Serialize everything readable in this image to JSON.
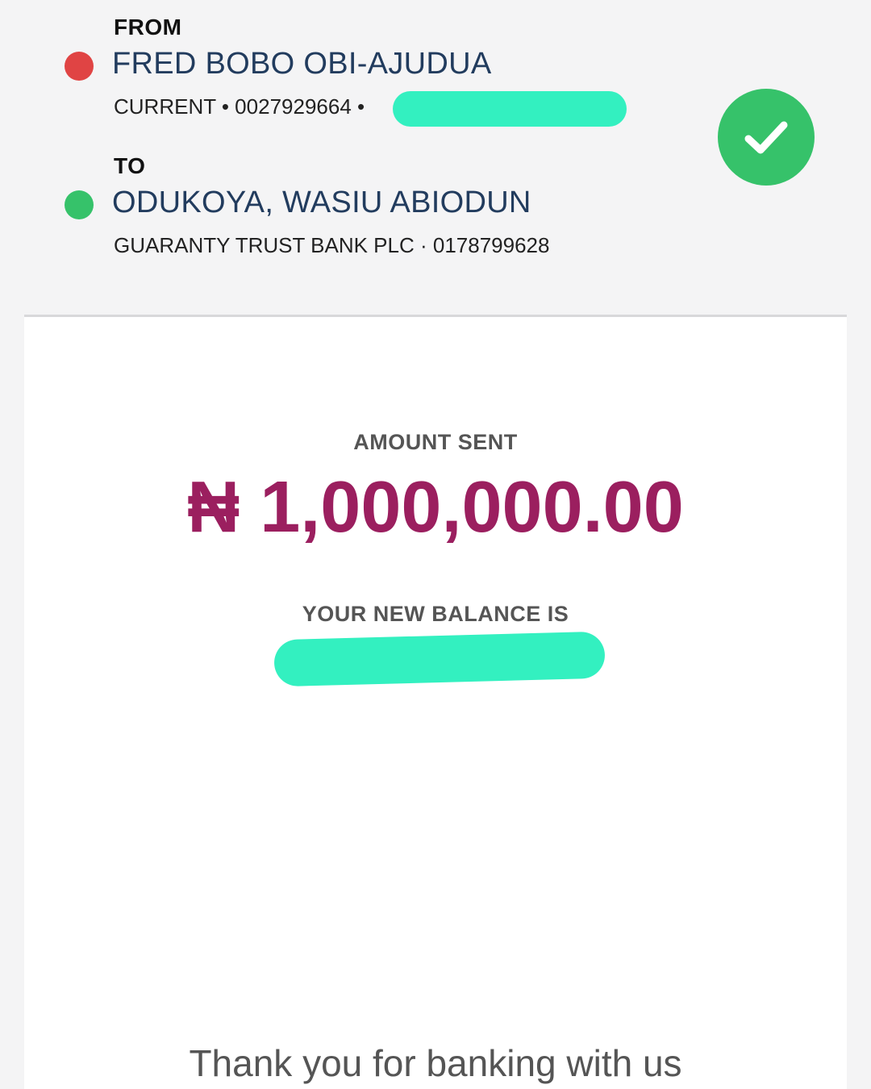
{
  "from": {
    "label": "FROM",
    "name": "FRED BOBO OBI-AJUDUA",
    "detail": "CURRENT • 0027929664 •",
    "dot_color": "#e04444"
  },
  "to": {
    "label": "TO",
    "name": "ODUKOYA, WASIU ABIODUN",
    "detail": "GUARANTY TRUST BANK PLC · 0178799628",
    "dot_color": "#36c26a"
  },
  "status": {
    "icon": "check-icon",
    "color": "#36c26a"
  },
  "receipt": {
    "amount_label": "AMOUNT SENT",
    "amount": "₦ 1,000,000.00",
    "amount_color": "#9b1f5f",
    "balance_label": "YOUR NEW BALANCE IS",
    "thanks": "Thank you for banking with us"
  },
  "redaction_color": "#33f0c0"
}
